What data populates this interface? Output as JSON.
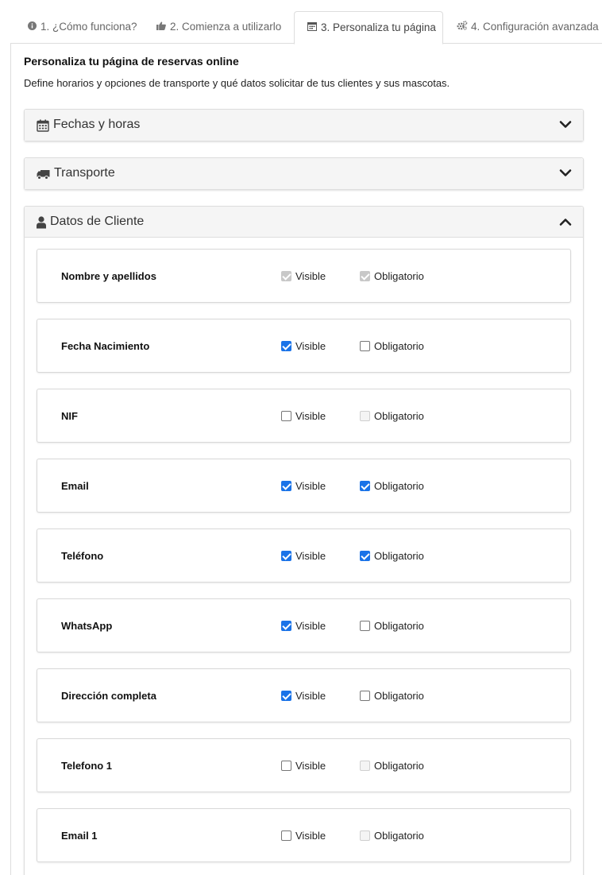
{
  "tabs": [
    {
      "label": "1. ¿Cómo funciona?",
      "icon": "info-circle-icon"
    },
    {
      "label": "2. Comienza a utilizarlo",
      "icon": "thumbs-up-icon"
    },
    {
      "label": "3. Personaliza tu página",
      "icon": "calendar-icon",
      "active": true
    },
    {
      "label": "4. Configuración avanzada",
      "icon": "gears-icon"
    }
  ],
  "page": {
    "title": "Personaliza tu página de reservas online",
    "description": "Define horarios y opciones de transporte y qué datos solicitar de tus clientes y sus mascotas."
  },
  "panels": [
    {
      "title": "Fechas y horas",
      "icon": "calendar-icon",
      "expanded": false
    },
    {
      "title": "Transporte",
      "icon": "truck-icon",
      "expanded": false
    },
    {
      "title": "Datos de Cliente",
      "icon": "user-icon",
      "expanded": true
    }
  ],
  "options": {
    "visible_label": "Visible",
    "required_label": "Obligatorio"
  },
  "fields": [
    {
      "name": "Nombre y apellidos",
      "visible": true,
      "required": true,
      "visible_disabled": true,
      "required_disabled": true
    },
    {
      "name": "Fecha Nacimiento",
      "visible": true,
      "required": false,
      "visible_disabled": false,
      "required_disabled": false
    },
    {
      "name": "NIF",
      "visible": false,
      "required": false,
      "visible_disabled": false,
      "required_disabled": true
    },
    {
      "name": "Email",
      "visible": true,
      "required": true,
      "visible_disabled": false,
      "required_disabled": false
    },
    {
      "name": "Teléfono",
      "visible": true,
      "required": true,
      "visible_disabled": false,
      "required_disabled": false
    },
    {
      "name": "WhatsApp",
      "visible": true,
      "required": false,
      "visible_disabled": false,
      "required_disabled": false
    },
    {
      "name": "Dirección completa",
      "visible": true,
      "required": false,
      "visible_disabled": false,
      "required_disabled": false
    },
    {
      "name": "Telefono 1",
      "visible": false,
      "required": false,
      "visible_disabled": false,
      "required_disabled": true
    },
    {
      "name": "Email 1",
      "visible": false,
      "required": false,
      "visible_disabled": false,
      "required_disabled": true
    }
  ],
  "colors": {
    "accent": "#1a73e8",
    "panel_header": "#f5f5f5",
    "border": "#dddddd"
  }
}
